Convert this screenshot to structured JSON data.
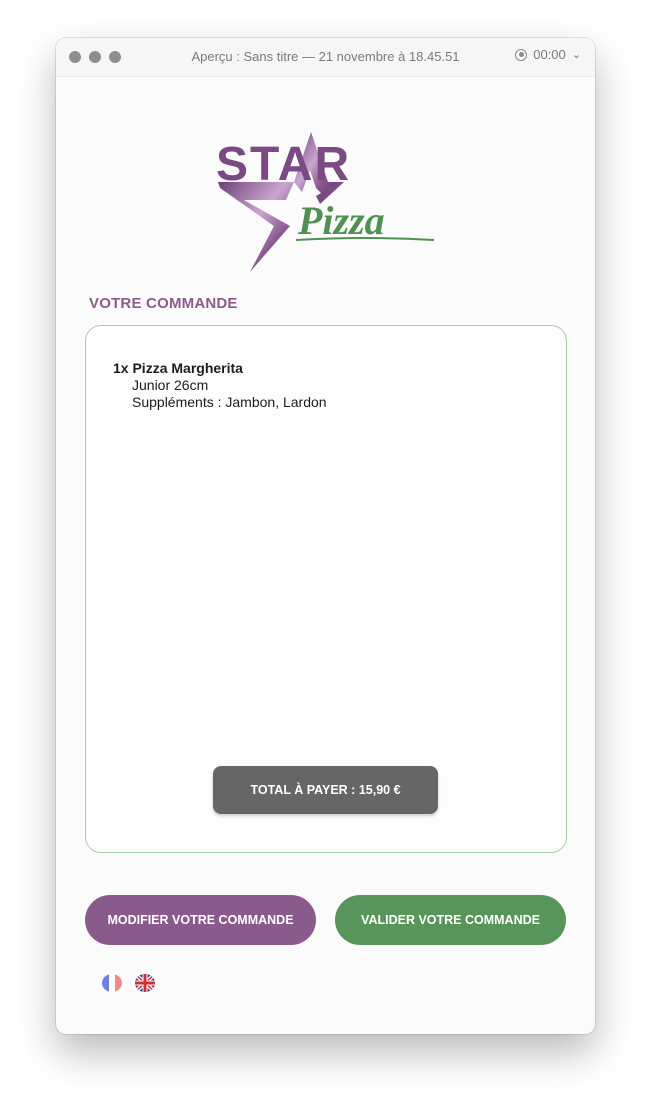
{
  "window": {
    "title": "Aperçu : Sans titre — 21 novembre à 18.45.51",
    "recording_time": "00:00"
  },
  "logo": {
    "brand_word1": "STAR",
    "brand_word2": "Pizza",
    "colors": {
      "purple": "#7a4a82",
      "green": "#4f9150"
    }
  },
  "order": {
    "section_title": "VOTRE COMMANDE",
    "items": [
      {
        "quantity_name": "1x Pizza Margherita",
        "size": "Junior 26cm",
        "extras": "Suppléments : Jambon, Lardon"
      }
    ],
    "total_label": "TOTAL À PAYER : 15,90 €"
  },
  "actions": {
    "modify_label": "MODIFIER VOTRE COMMANDE",
    "validate_label": "VALIDER VOTRE COMMANDE"
  },
  "languages": [
    {
      "code": "fr",
      "icon": "flag-fr-icon"
    },
    {
      "code": "en",
      "icon": "flag-uk-icon"
    }
  ],
  "colors": {
    "accent_purple": "#8a5a8c",
    "accent_green": "#57955a",
    "total_bg": "#666666",
    "box_border": "#a6cfa4"
  }
}
